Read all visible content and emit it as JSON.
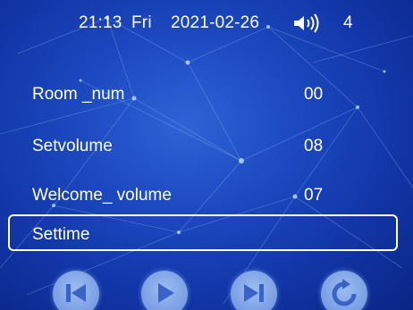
{
  "status": {
    "time": "21:13",
    "day": "Fri",
    "date": "2021-02-26",
    "volume_icon": "speaker-volume-icon",
    "volume_level": "4"
  },
  "menu": {
    "items": [
      {
        "label": "Room _num",
        "value": "00"
      },
      {
        "label": "Setvolume",
        "value": "08"
      },
      {
        "label": "Welcome_ volume",
        "value": "07"
      },
      {
        "label": "Settime",
        "value": ""
      }
    ],
    "selected_index": 3
  },
  "controls": {
    "prev_icon": "skip-previous-icon",
    "play_icon": "play-icon",
    "next_icon": "skip-next-icon",
    "refresh_icon": "refresh-icon"
  },
  "colors": {
    "background": "#1c48bf",
    "text": "#ffffff",
    "button": "#7fa3e6",
    "button_glyph": "#3a63c8"
  }
}
